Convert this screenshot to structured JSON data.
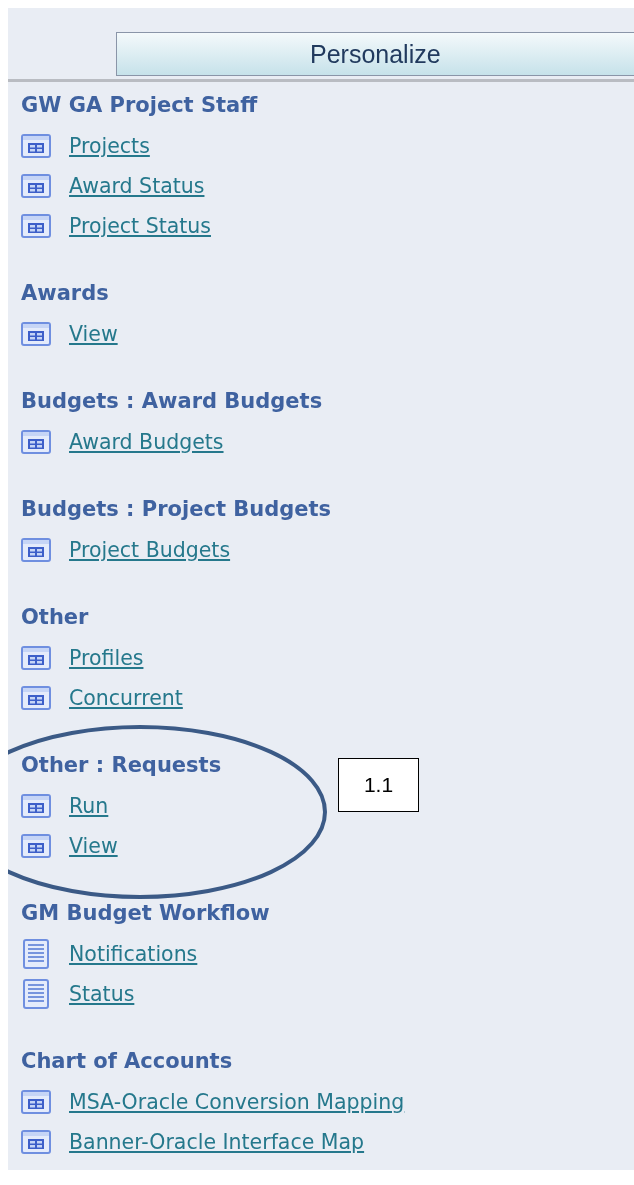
{
  "toolbar": {
    "button": "Personalize"
  },
  "sections": [
    {
      "title": "GW GA Project Staff",
      "items": [
        {
          "kind": "form",
          "label": "Projects"
        },
        {
          "kind": "form",
          "label": "Award Status"
        },
        {
          "kind": "form",
          "label": "Project Status"
        }
      ]
    },
    {
      "title": "Awards",
      "items": [
        {
          "kind": "form",
          "label": "View"
        }
      ]
    },
    {
      "title": "Budgets : Award Budgets",
      "items": [
        {
          "kind": "form",
          "label": "Award Budgets"
        }
      ]
    },
    {
      "title": "Budgets : Project Budgets",
      "items": [
        {
          "kind": "form",
          "label": "Project Budgets"
        }
      ]
    },
    {
      "title": "Other",
      "items": [
        {
          "kind": "form",
          "label": "Profiles"
        },
        {
          "kind": "form",
          "label": "Concurrent"
        }
      ]
    },
    {
      "title": "Other : Requests",
      "items": [
        {
          "kind": "form",
          "label": "Run"
        },
        {
          "kind": "form",
          "label": "View"
        }
      ]
    },
    {
      "title": "GM Budget Workflow",
      "items": [
        {
          "kind": "document",
          "label": "Notifications"
        },
        {
          "kind": "document",
          "label": "Status"
        }
      ]
    },
    {
      "title": "Chart of Accounts",
      "items": [
        {
          "kind": "form",
          "label": "MSA-Oracle Conversion Mapping"
        },
        {
          "kind": "form",
          "label": "Banner-Oracle Interface Map"
        }
      ]
    }
  ],
  "callout": {
    "label": "1.1"
  }
}
